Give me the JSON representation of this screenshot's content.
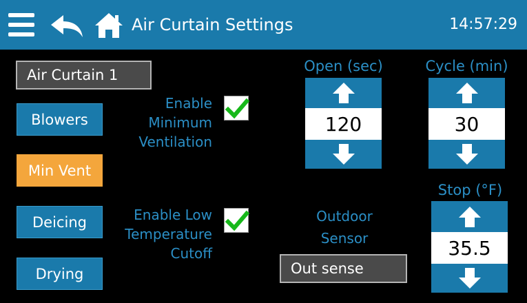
{
  "header": {
    "title": "Air Curtain Settings",
    "time": "14:57:29",
    "icons": [
      "menu-icon",
      "back-icon",
      "home-icon"
    ]
  },
  "unit_select": {
    "value": "Air Curtain 1"
  },
  "nav": {
    "blowers": "Blowers",
    "min_vent": "Min Vent",
    "deicing": "Deicing",
    "drying": "Drying",
    "active": "Min Vent"
  },
  "options": {
    "min_vent_label_1": "Enable",
    "min_vent_label_2": "Minimum",
    "min_vent_label_3": "Ventilation",
    "min_vent_checked": true,
    "low_temp_label_1": "Enable Low",
    "low_temp_label_2": "Temperature",
    "low_temp_label_3": "Cutoff",
    "low_temp_checked": true
  },
  "open": {
    "label": "Open (sec)",
    "value": "120"
  },
  "cycle": {
    "label": "Cycle (min)",
    "value": "30"
  },
  "stop": {
    "label": "Stop (°F)",
    "value": "35.5"
  },
  "sensor": {
    "label_1": "Outdoor",
    "label_2": "Sensor",
    "value": "Out sense"
  },
  "colors": {
    "header": "#1a7aab",
    "accent": "#2b8fc6",
    "active": "#f4a63c",
    "check": "#17b81a"
  }
}
